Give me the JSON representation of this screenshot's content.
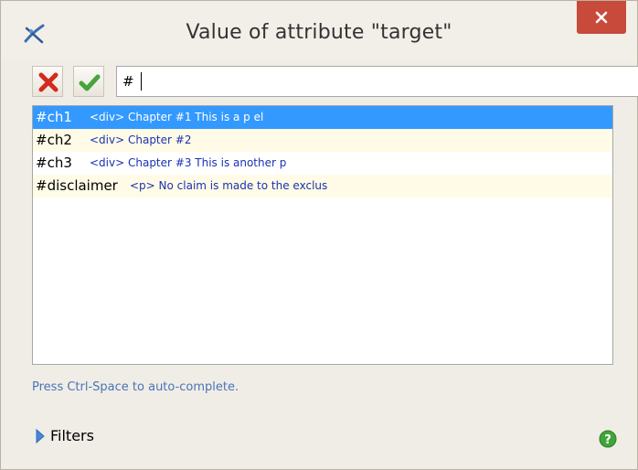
{
  "window": {
    "title": "Value of attribute \"target\""
  },
  "toolbar": {
    "input_value": "#"
  },
  "suggestions": [
    {
      "anchor": "#ch1",
      "description": "<div> Chapter #1 This is a p el"
    },
    {
      "anchor": "#ch2",
      "description": "<div> Chapter #2"
    },
    {
      "anchor": "#ch3",
      "description": "<div> Chapter #3 This is another p"
    },
    {
      "anchor": "#disclaimer",
      "description": "<p> No claim is made to the exclus"
    }
  ],
  "hint": "Press Ctrl-Space to auto-complete.",
  "filters": {
    "label": "Filters"
  },
  "colors": {
    "selection": "#3399ff",
    "alt_row": "#fffbe6",
    "description_text": "#1a32b4",
    "close_button": "#c74a3b"
  }
}
